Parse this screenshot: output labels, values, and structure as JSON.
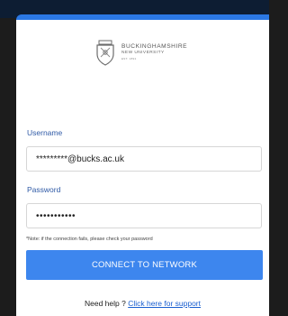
{
  "logo": {
    "line1": "BUCKINGHAMSHIRE",
    "line2": "NEW UNIVERSITY",
    "line3": "EST. 1891"
  },
  "form": {
    "username_label": "Username",
    "username_value": "*********@bucks.ac.uk",
    "password_label": "Password",
    "password_value": "•••••••••••",
    "note": "*Note: if the connection fails, please check your password",
    "connect_label": "CONNECT TO NETWORK"
  },
  "help": {
    "prefix": "Need help ?",
    "link": "Click here for support"
  },
  "colors": {
    "accent": "#2b78e4",
    "button": "#3d86ee",
    "label": "#2f5aa6",
    "link": "#1a5fd0"
  }
}
